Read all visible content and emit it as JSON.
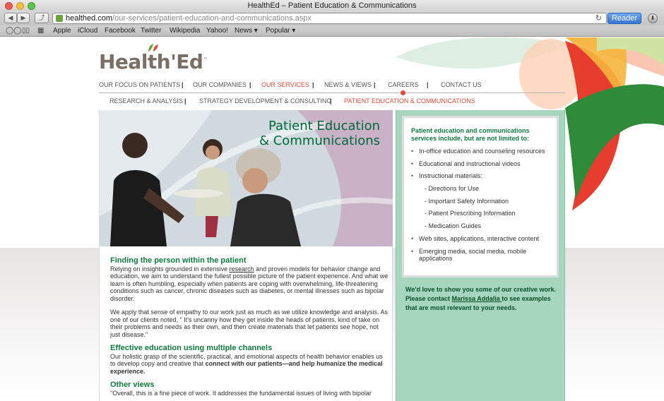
{
  "window": {
    "title": "HealthEd – Patient Education & Communications"
  },
  "toolbar": {
    "back_label": "◀",
    "forward_label": "▶",
    "share_label": "⤴",
    "url_domain": "healthed.com",
    "url_path": "/our-services/patient-education-and-communications.aspx",
    "reader_label": "Reader",
    "download_label": "⬇",
    "reload_label": "↻"
  },
  "bookmarks": {
    "items": [
      "Apple",
      "iCloud",
      "Facebook",
      "Twitter",
      "Wikipedia",
      "Yahoo!",
      "News ▾",
      "Popular ▾"
    ]
  },
  "site": {
    "logo_text": "Health'Ed",
    "logo_tm": "™",
    "nav_main": [
      "OUR FOCUS ON PATIENTS",
      "OUR COMPANIES",
      "OUR SERVICES",
      "NEWS & VIEWS",
      "CAREERS",
      "CONTACT US"
    ],
    "nav_sub": [
      "RESEARCH & ANALYSIS",
      "STRATEGY DEVELOPMENT & CONSULTING",
      "PATIENT EDUCATION & COMMUNICATIONS"
    ],
    "separator": "|"
  },
  "hero": {
    "title_line1": "Patient Education",
    "title_line2": "& Communications"
  },
  "article": {
    "h1": "Finding the person within the patient",
    "p1_pre": "Relying on insights grounded in extensive ",
    "p1_link": "research",
    "p1_post": " and proven models for behavior change and education, we aim to understand the fullest possible picture of the patient experience. And what we learn is often humbling, especially when patients are coping with overwhelming, life-threatening conditions such as cancer, chronic diseases such as diabetes, or mental illnesses such as bipolar disorder.",
    "p2": "We apply that sense of empathy to our work just as much as we utilize knowledge and analysis. As one of our clients noted, \" It's uncanny how they get inside the heads of patients, kind of take on their problems and needs as their own, and then create materials that let patients see hope, not just disease.\"",
    "h2": "Effective education using multiple channels",
    "p3_pre": "Our holistic grasp of the scientific, practical, and emotional aspects of health behavior enables us to develop copy and creative that ",
    "p3_bold": "connect with our patients—and help humanize the medical experience.",
    "h3": "Other views",
    "p4": "\"Overall, this is a fine piece of work. It addresses the fundamental issues of living with bipolar"
  },
  "sidebar": {
    "heading": "Patient education and communications services include, but are not limited to:",
    "items": [
      "In-office education and counseling resources",
      "Educational and instructional videos",
      "Instructional materials:",
      "- Directions for Use",
      "- Important Safety Information",
      "- Patient Prescribing Information",
      "- Medication Guides",
      "Web sites, applications, interactive content",
      "Emerging media, social media, mobile applications"
    ],
    "cta_pre": "We'd love to show you some of our creative work. Please contact ",
    "cta_link": "Marissa Addalia ",
    "cta_post": "to see examples that are most relevant to your needs."
  },
  "colors": {
    "accent_red": "#e14b37",
    "brand_green": "#0d7c3e",
    "sidebar_green": "#a6d6bd"
  }
}
